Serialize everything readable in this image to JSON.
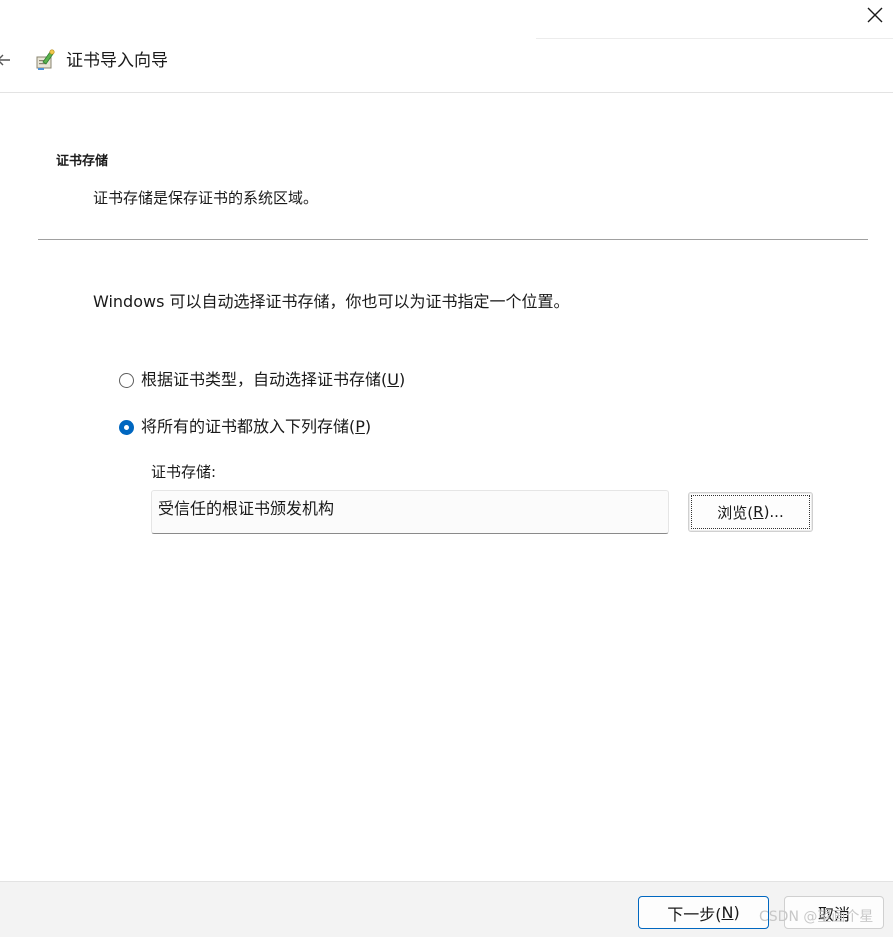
{
  "window": {
    "title": "证书导入向导",
    "close_icon": "close-icon",
    "back_icon": "back-arrow-icon",
    "wizard_icon": "certificate-wizard-icon"
  },
  "section": {
    "title": "证书存储",
    "description": "证书存储是保存证书的系统区域。"
  },
  "intro": "Windows 可以自动选择证书存储，你也可以为证书指定一个位置。",
  "options": [
    {
      "label": "根据证书类型，自动选择证书存储(",
      "mnemonic": "U",
      "suffix": ")",
      "checked": false
    },
    {
      "label": "将所有的证书都放入下列存储(",
      "mnemonic": "P",
      "suffix": ")",
      "checked": true
    }
  ],
  "store": {
    "label": "证书存储:",
    "value": "受信任的根证书颁发机构",
    "browse_prefix": "浏览(",
    "browse_mnemonic": "R",
    "browse_suffix": ")..."
  },
  "footer": {
    "next_prefix": "下一步(",
    "next_mnemonic": "N",
    "next_suffix": ")",
    "cancel": "取消"
  },
  "watermark": "CSDN @望画个星",
  "colors": {
    "accent": "#0067c0",
    "divider": "#a0a0a0",
    "footer_bg": "#f3f3f3"
  }
}
